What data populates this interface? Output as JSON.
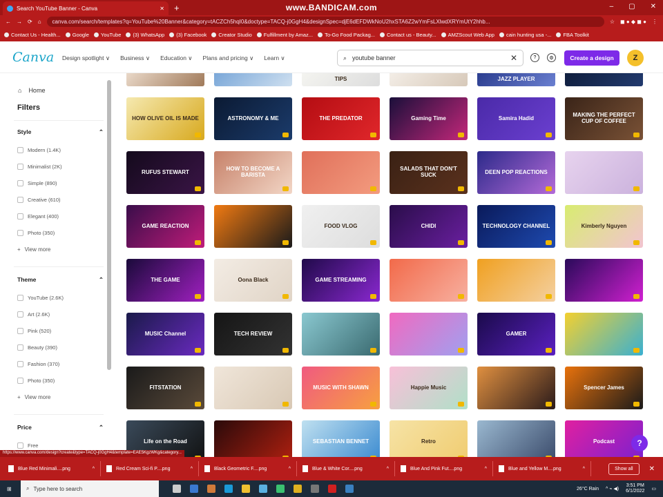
{
  "browser": {
    "tab_title": "Search YouTube Banner - Canva",
    "recorder_watermark": "www.BANDICAM.com",
    "url": "canva.com/search/templates?q=YouTube%20Banner&category=tACZCh5hqI0&doctype=TACQ-j0GgH4&designSpec=djE6dEFDWkNoU2hxSTA6Z2wYmFsLXlwdXRYmUtY2hhb...",
    "bookmarks": [
      "Contact Us - Health...",
      "Google",
      "YouTube",
      "(3) WhatsApp",
      "(3) Facebook",
      "Creator Studio",
      "Fulfillment by Amaz...",
      "To-Go Food Packag...",
      "Contact us - Beauty...",
      "AMZScout Web App",
      "cain hunting usa -...",
      "FBA Toolkit"
    ]
  },
  "header": {
    "logo": "Canva",
    "nav": [
      "Design spotlight ∨",
      "Business ∨",
      "Education ∨",
      "Plans and pricing ∨",
      "Learn ∨"
    ],
    "search_value": "youtube banner",
    "create_label": "Create a design",
    "avatar_initial": "Z"
  },
  "sidebar": {
    "home": "Home",
    "filters": "Filters",
    "sections": [
      {
        "title": "Style",
        "options": [
          "Modern (1.4K)",
          "Minimalist (2K)",
          "Simple (890)",
          "Creative (610)",
          "Elegant (400)",
          "Photo (350)"
        ],
        "more": "View more"
      },
      {
        "title": "Theme",
        "options": [
          "YouTube (2.6K)",
          "Art (2.6K)",
          "Pink (520)",
          "Beauty (390)",
          "Fashion (370)",
          "Photo (350)"
        ],
        "more": "View more"
      },
      {
        "title": "Price",
        "options": [
          "Free"
        ],
        "more": ""
      }
    ]
  },
  "templates": [
    {
      "text": "",
      "bg": [
        "#e9d8c8",
        "#a07a5a"
      ]
    },
    {
      "text": "",
      "bg": [
        "#7aa7d8",
        "#cfe0f0"
      ]
    },
    {
      "text": "TIPS",
      "bg": [
        "#f4f4f0",
        "#ddd"
      ],
      "dark": true
    },
    {
      "text": "",
      "bg": [
        "#f3ede6",
        "#d7c9b9"
      ]
    },
    {
      "text": "JAZZ PLAYER",
      "bg": [
        "#2b3d8f",
        "#6a7fd0"
      ]
    },
    {
      "text": "",
      "bg": [
        "#0f1e3d",
        "#223a6e"
      ]
    },
    {
      "text": "HOW OLIVE OIL IS MADE",
      "bg": [
        "#f5e9b0",
        "#d8a91e"
      ],
      "dark": true
    },
    {
      "text": "ASTRONOMY & ME",
      "bg": [
        "#0b1a33",
        "#1b3b6b"
      ]
    },
    {
      "text": "THE PREDATOR",
      "bg": [
        "#b40d12",
        "#e0272b"
      ]
    },
    {
      "text": "Gaming Time",
      "bg": [
        "#1a0f3a",
        "#c3277a"
      ]
    },
    {
      "text": "Samira Hadid",
      "bg": [
        "#4a2aa8",
        "#6b3fd0"
      ]
    },
    {
      "text": "MAKING THE PERFECT CUP OF COFFEE",
      "bg": [
        "#3a2418",
        "#7a5236"
      ]
    },
    {
      "text": "RUFUS STEWART",
      "bg": [
        "#140a1c",
        "#3a1446"
      ]
    },
    {
      "text": "HOW TO BECOME A BARISTA",
      "bg": [
        "#c7826a",
        "#f2d6c6"
      ]
    },
    {
      "text": "",
      "bg": [
        "#e0705a",
        "#f39b7f"
      ]
    },
    {
      "text": "SALADS THAT DON'T SUCK",
      "bg": [
        "#3a2114",
        "#5a311d"
      ]
    },
    {
      "text": "DEEN POP REACTIONS",
      "bg": [
        "#2c2a8a",
        "#b36ad8"
      ]
    },
    {
      "text": "",
      "bg": [
        "#e7d3ee",
        "#cbb2dd"
      ],
      "dark": true
    },
    {
      "text": "GAME REACTION",
      "bg": [
        "#3a0d4a",
        "#c01c7a"
      ]
    },
    {
      "text": "",
      "bg": [
        "#f07a12",
        "#1a1a1a"
      ]
    },
    {
      "text": "FOOD VLOG",
      "bg": [
        "#f0f0f0",
        "#ddd"
      ],
      "dark": true
    },
    {
      "text": "CHIDI",
      "bg": [
        "#2a0d4a",
        "#6a1fa0"
      ]
    },
    {
      "text": "TECHNOLOGY CHANNEL",
      "bg": [
        "#0a1a5a",
        "#1e4ab0"
      ]
    },
    {
      "text": "Kimberly Nguyen",
      "bg": [
        "#d8ec70",
        "#f2c4d0"
      ],
      "dark": true
    },
    {
      "text": "THE GAME",
      "bg": [
        "#1a0a3a",
        "#a020c0"
      ]
    },
    {
      "text": "Oona Black",
      "bg": [
        "#f3ece4",
        "#e0d4c6"
      ],
      "dark": true
    },
    {
      "text": "GAME STREAMING",
      "bg": [
        "#200a4a",
        "#8a28d0"
      ]
    },
    {
      "text": "",
      "bg": [
        "#f26a4a",
        "#f7b0a0"
      ]
    },
    {
      "text": "",
      "bg": [
        "#f0a020",
        "#f4d0a0"
      ],
      "dark": true
    },
    {
      "text": "",
      "bg": [
        "#2a0a5a",
        "#d020d0"
      ]
    },
    {
      "text": "MUSIC Channel",
      "bg": [
        "#1a1a4a",
        "#6a2ac0"
      ]
    },
    {
      "text": "TECH REVIEW",
      "bg": [
        "#151515",
        "#333"
      ]
    },
    {
      "text": "",
      "bg": [
        "#8ac8d0",
        "#3a6a70"
      ]
    },
    {
      "text": "",
      "bg": [
        "#f06ac0",
        "#a0a0f0"
      ]
    },
    {
      "text": "GAMER",
      "bg": [
        "#1a0a4a",
        "#5a20c0"
      ]
    },
    {
      "text": "",
      "bg": [
        "#f3d030",
        "#3ab0d0"
      ]
    },
    {
      "text": "FITSTATION",
      "bg": [
        "#1a1a1a",
        "#5a4a3a"
      ]
    },
    {
      "text": "",
      "bg": [
        "#f0e6da",
        "#d8c8b4"
      ],
      "dark": true
    },
    {
      "text": "MUSIC WITH SHAWN",
      "bg": [
        "#f05a80",
        "#f7a040"
      ]
    },
    {
      "text": "Happie Music",
      "bg": [
        "#f8c0d8",
        "#b0e0c8"
      ],
      "dark": true
    },
    {
      "text": "",
      "bg": [
        "#e09040",
        "#2a1a1a"
      ]
    },
    {
      "text": "Spencer James",
      "bg": [
        "#e8720c",
        "#1a1a1a"
      ]
    },
    {
      "text": "Life on the Road",
      "bg": [
        "#3a4a5a",
        "#111"
      ]
    },
    {
      "text": "",
      "bg": [
        "#2a0a0a",
        "#b02010"
      ]
    },
    {
      "text": "SEBASTIAN BENNET",
      "bg": [
        "#bfe0f0",
        "#3a8ad0"
      ]
    },
    {
      "text": "Retro",
      "bg": [
        "#f6e3a6",
        "#f0cc70"
      ],
      "dark": true
    },
    {
      "text": "",
      "bg": [
        "#9ab8d0",
        "#3a4a6a"
      ]
    },
    {
      "text": "Podcast",
      "bg": [
        "#e020a0",
        "#7a20d0"
      ]
    }
  ],
  "status_url": "https://www.canva.com/design?create&type=TACQ-j0GgH4&template=EAE5KgzWKg&category...",
  "help_label": "?",
  "downloads": {
    "items": [
      "Blue Red Minimali....png",
      "Red Cream Sci-fi P....png",
      "Black Geometric F....png",
      "Blue & White Cor....png",
      "Blue And Pink Fut....png",
      "Blue and Yellow M....png"
    ],
    "show_all": "Show all"
  },
  "taskbar": {
    "search_placeholder": "Type here to search",
    "weather": "26°C Rain",
    "time": "3:51 PM",
    "date": "6/1/2022"
  }
}
